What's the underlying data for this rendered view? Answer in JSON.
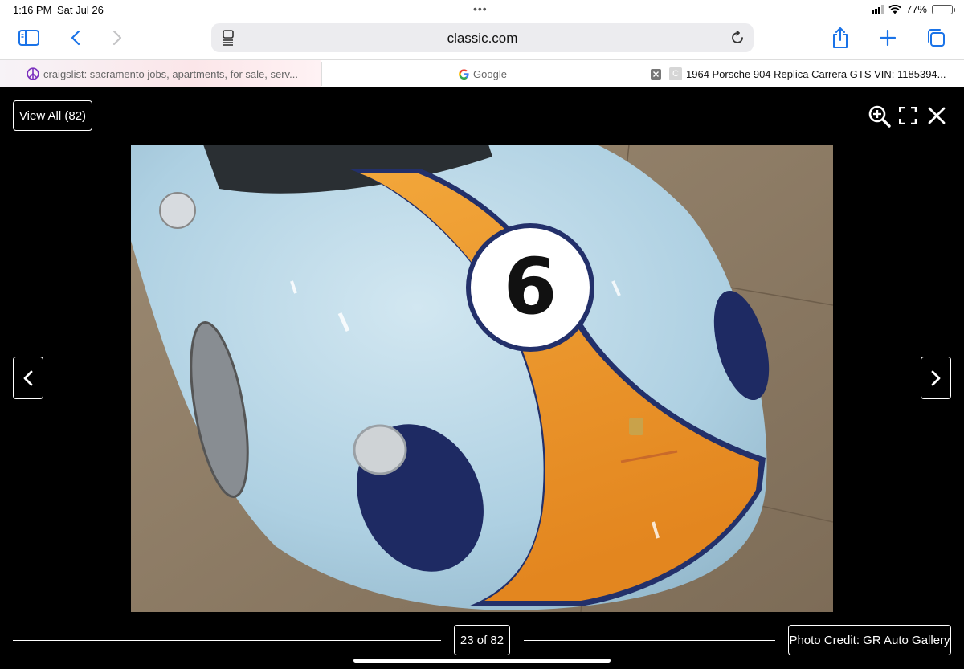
{
  "status_bar": {
    "time": "1:16 PM",
    "date": "Sat Jul 26",
    "battery_percent": "77%",
    "battery_level": 0.77
  },
  "browser": {
    "url": "classic.com",
    "icons": {
      "sidebar": "sidebar-icon",
      "back": "chevron-left-icon",
      "forward": "chevron-right-icon",
      "reader": "reader-icon",
      "reload": "reload-icon",
      "share": "share-icon",
      "new_tab": "plus-icon",
      "tabs_overview": "tabs-icon"
    },
    "accent_color": "#1a73e8"
  },
  "tabs": [
    {
      "label": "craigslist: sacramento jobs, apartments, for sale, serv...",
      "icon": "peace-icon"
    },
    {
      "label": "Google",
      "icon": "google-icon"
    },
    {
      "label": "1964 Porsche 904 Replica Carrera GTS VIN: 1185394...",
      "icon": "classic-favicon",
      "close_icon": "close-tab-icon",
      "favicon_letter": "C",
      "active": true
    }
  ],
  "gallery": {
    "view_all_label": "View All (82)",
    "counter": "23 of 82",
    "photo_credit": "Photo Credit: GR Auto Gallery",
    "controls": {
      "zoom": "zoom-in-icon",
      "fullscreen": "fullscreen-icon",
      "close": "close-icon",
      "prev": "chevron-left-icon",
      "next": "chevron-right-icon"
    },
    "photo": {
      "race_number": "6",
      "car_colors": {
        "body": "#aed0e2",
        "stripe": "#ec9a2c",
        "pinstripe": "#23306a",
        "floor": "#8b7a64"
      }
    }
  }
}
